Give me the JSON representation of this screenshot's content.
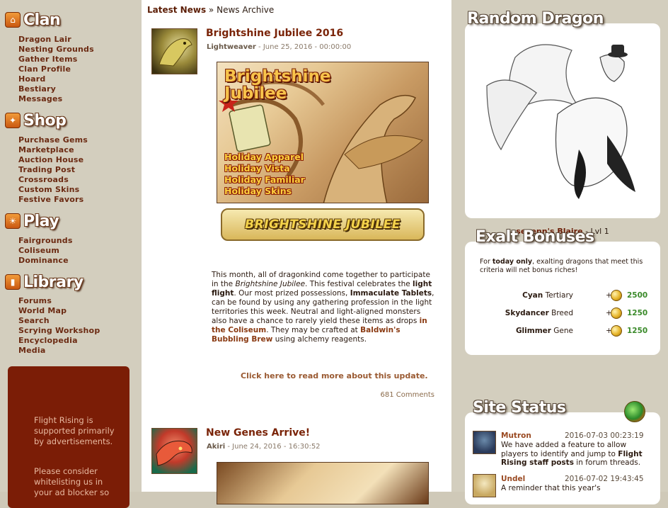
{
  "sidebar": {
    "clan": {
      "title": "Clan",
      "items": [
        "Dragon Lair",
        "Nesting Grounds",
        "Gather Items",
        "Clan Profile",
        "Hoard",
        "Bestiary",
        "Messages"
      ]
    },
    "shop": {
      "title": "Shop",
      "items": [
        "Purchase Gems",
        "Marketplace",
        "Auction House",
        "Trading Post",
        "Crossroads",
        "Custom Skins",
        "Festive Favors"
      ]
    },
    "play": {
      "title": "Play",
      "items": [
        "Fairgrounds",
        "Coliseum",
        "Dominance"
      ]
    },
    "library": {
      "title": "Library",
      "items": [
        "Forums",
        "World Map",
        "Search",
        "Scrying Workshop",
        "Encyclopedia",
        "Media"
      ]
    },
    "ad": {
      "line1": "Flight Rising is supported primarily by advertisements.",
      "line2": "Please consider whitelisting us in your ad blocker so"
    }
  },
  "breadcrumb": {
    "link": "Latest News",
    "sep": "»",
    "current": "News Archive"
  },
  "posts": [
    {
      "title": "Brightshine Jubilee 2016",
      "author": "Lightweaver",
      "date": "June 25, 2016 - 00:00:00",
      "banner_title": "Brightshine Jubilee",
      "banner_items": [
        "Holiday Apparel",
        "Holiday Vista",
        "Holiday Familiar",
        "Holiday Skins"
      ],
      "logo_text": "BRIGHTSHINE JUBILEE",
      "body": {
        "p1": "This month, all of dragonkind come together to participate in the ",
        "em1": "Brightshine Jubilee",
        "p2": ". This festival celebrates the ",
        "b1": "light flight",
        "p3": ". Our most prized possessions, ",
        "b2": "Immaculate Tablets",
        "p4": ", can be found by using any gathering profession in the light territories this week. Neutral and light-aligned monsters also have a chance to rarely yield these items as drops ",
        "link1": "in the Coliseum",
        "p5": ". They may be crafted at ",
        "link2": "Baldwin's Bubbling Brew",
        "p6": " using alchemy reagents."
      },
      "read_more": "Click here to read more about this update.",
      "comments": "681 Comments"
    },
    {
      "title": "New Genes Arrive!",
      "author": "Akiri",
      "date": "June 24, 2016 - 16:30:52"
    }
  ],
  "random_dragon": {
    "title": "Random Dragon",
    "name": "sevenn's Blaire",
    "level": "- Lvl 1"
  },
  "exalt": {
    "title": "Exalt Bonuses",
    "intro_pre": "For ",
    "intro_bold": "today only",
    "intro_post": ", exalting dragons that meet this criteria will net bonus riches!",
    "rows": [
      {
        "name": "Cyan",
        "type": "Tertiary",
        "amount": "2500"
      },
      {
        "name": "Skydancer",
        "type": "Breed",
        "amount": "1250"
      },
      {
        "name": "Glimmer",
        "type": "Gene",
        "amount": "1250"
      }
    ]
  },
  "site_status": {
    "title": "Site Status",
    "items": [
      {
        "user": "Mutron",
        "time": "2016-07-03 00:23:19",
        "text_pre": "We have added a feature to allow players to identify and jump to ",
        "text_bold": "Flight Rising staff posts",
        "text_post": " in forum threads."
      },
      {
        "user": "Undel",
        "time": "2016-07-02 19:43:45",
        "text_pre": "A reminder that this year's",
        "text_bold": "",
        "text_post": ""
      }
    ]
  },
  "colors": {
    "sidebar_bg": "#d3cebe",
    "link": "#6b2a12",
    "ad_bg": "#7b1d06",
    "bonus_green": "#3a8a2a"
  }
}
